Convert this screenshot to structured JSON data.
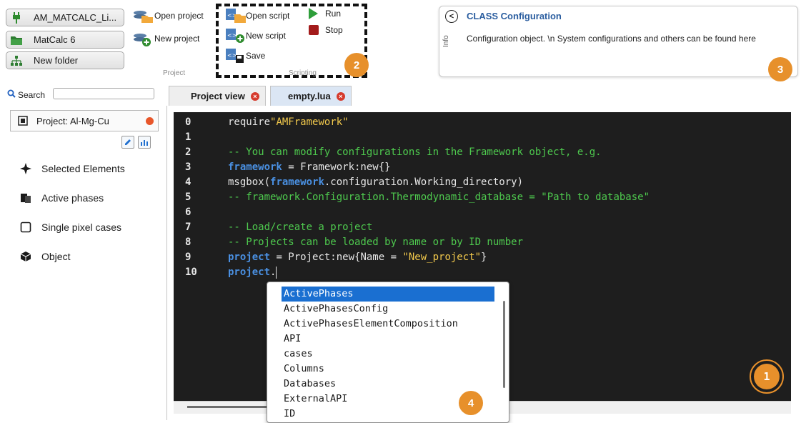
{
  "launch_buttons": [
    {
      "label": "AM_MATCALC_Li..."
    },
    {
      "label": "MatCalc 6"
    },
    {
      "label": "New folder"
    }
  ],
  "ribbon": {
    "project_group": {
      "label": "Project",
      "open_project": "Open project",
      "new_project": "New project"
    },
    "scripting_group": {
      "label": "Scripting",
      "open_script": "Open script",
      "new_script": "New script",
      "save": "Save",
      "run": "Run",
      "stop": "Stop"
    }
  },
  "badges": {
    "b1": "1",
    "b2": "2",
    "b3": "3",
    "b4": "4"
  },
  "info_panel": {
    "title": "CLASS Configuration",
    "side_label": "Info",
    "text": "Configuration object. \\n System configurations and others can be found here"
  },
  "left_panel": {
    "search_label": "Search",
    "search_value": "",
    "project_label": "Project: Al-Mg-Cu",
    "items": [
      {
        "label": "Selected Elements"
      },
      {
        "label": "Active phases"
      },
      {
        "label": "Single pixel cases"
      },
      {
        "label": "Object"
      }
    ]
  },
  "tabs": [
    {
      "label": "Project view"
    },
    {
      "label": "empty.lua"
    }
  ],
  "editor": {
    "line_numbers": [
      "0",
      "1",
      "2",
      "3",
      "4",
      "5",
      "6",
      "7",
      "8",
      "9",
      "10"
    ]
  },
  "autocomplete": {
    "items": [
      "ActivePhases",
      "ActivePhasesConfig",
      "ActivePhasesElementComposition",
      "API",
      "cases",
      "Columns",
      "Databases",
      "ExternalAPI",
      "ID"
    ],
    "selected_index": 0
  },
  "colors": {
    "accent_blue": "#2a5d9f",
    "badge_orange": "#e7902b",
    "editor_bg": "#1e1e1e",
    "comment_green": "#4ec94e",
    "string_yellow": "#f2c94c",
    "keyword_blue": "#4a90e2",
    "selection_blue": "#1a6fd1",
    "close_red": "#d63a2c"
  }
}
